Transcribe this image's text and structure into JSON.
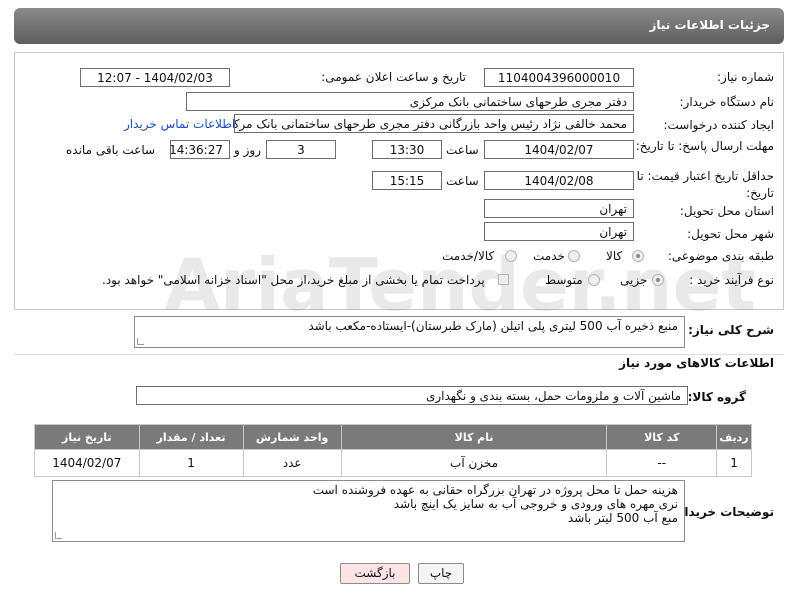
{
  "header": {
    "title": "جزئیات اطلاعات نیاز"
  },
  "form": {
    "need_number_label": "شماره نیاز:",
    "need_number": "1104004396000010",
    "announce_label": "تاریخ و ساعت اعلان عمومی:",
    "announce_value": "1404/02/03 - 12:07",
    "buyer_org_label": "نام دستگاه خریدار:",
    "buyer_org": "دفتر مجری طرحهای ساختمانی بانک مرکزی",
    "requester_label": "ایجاد کننده درخواست:",
    "requester": "محمد خالقی نژاد رئیس واحد بازرگانی دفتر مجری طرحهای ساختمانی بانک مرکزی",
    "contact_link": "اطلاعات تماس خریدار",
    "deadline_label": "مهلت ارسال پاسخ: تا تاریخ:",
    "deadline_date": "1404/02/07",
    "time_label": "ساعت",
    "deadline_time": "13:30",
    "days_value": "3",
    "days_label": "روز و",
    "remaining_time": "14:36:27",
    "remaining_label": "ساعت باقی مانده",
    "min_price_label": "حداقل تاریخ اعتبار قیمت: تا تاریخ:",
    "min_price_date": "1404/02/08",
    "min_price_time": "15:15",
    "province_label": "استان محل تحویل:",
    "province": "تهران",
    "city_label": "شهر محل تحویل:",
    "city": "تهران",
    "category_label": "طبقه بندی موضوعی:",
    "category_options": [
      "کالا",
      "خدمت",
      "کالا/خدمت"
    ],
    "process_label": "نوع فرآیند خرید :",
    "process_options": [
      "جزیی",
      "متوسط"
    ],
    "payment_note": "پرداخت تمام یا بخشی از مبلغ خرید،از محل \"اسناد خزانه اسلامی\" خواهد بود."
  },
  "description": {
    "label": "شرح کلی نیاز:",
    "text": "منبع ذخیره آب 500 لیتری پلی اتیلن (مارک طبرستان)-ایستاده-مکعب باشد"
  },
  "goods": {
    "section_title": "اطلاعات کالاهای مورد نیاز",
    "group_label": "گروه کالا:",
    "group_value": "ماشین آلات و ملزومات حمل، بسته بندی و نگهداری",
    "columns": [
      "ردیف",
      "کد کالا",
      "نام کالا",
      "واحد شمارش",
      "تعداد / مقدار",
      "تاریخ نیاز"
    ],
    "rows": [
      [
        "1",
        "--",
        "مخزن آب",
        "عدد",
        "1",
        "1404/02/07"
      ]
    ]
  },
  "buyer_notes": {
    "label": "توضیحات خریدار:",
    "lines": [
      "هزینه حمل تا محل پروژه در تهران بزرگراه حقانی به عهده فروشنده است",
      "نری مهره های ورودی و خروجی آب به سایز یک اینچ باشد",
      "مبع آب 500 لیتر باشد"
    ]
  },
  "buttons": {
    "print": "چاپ",
    "back": "بازگشت"
  },
  "watermark": "AriaTender.net",
  "colors": {
    "header_bg": "#6e6e6e",
    "link": "#1a4fb5",
    "back_button_bg": "#fde3e3"
  }
}
